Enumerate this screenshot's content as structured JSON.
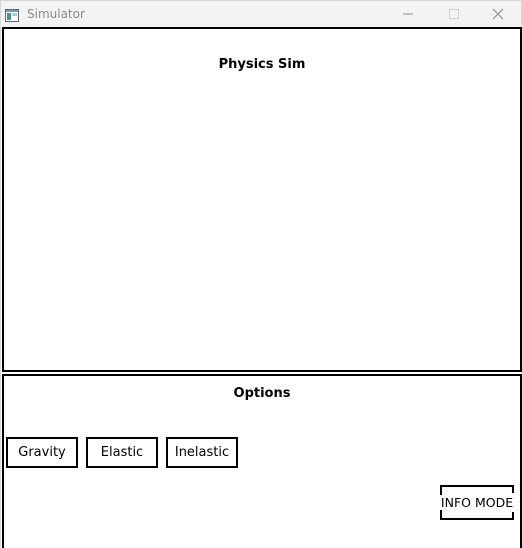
{
  "window": {
    "title": "Simulator"
  },
  "simulation": {
    "title": "Physics Sim"
  },
  "options": {
    "title": "Options",
    "buttons": [
      {
        "label": "Gravity"
      },
      {
        "label": "Elastic"
      },
      {
        "label": "Inelastic"
      }
    ],
    "info_mode_label": "INFO MODE"
  },
  "icons": {
    "app": "window-app-icon",
    "minimize": "minimize-icon",
    "maximize": "maximize-icon",
    "close": "close-icon"
  },
  "colors": {
    "titlebar": "#f3f3f3",
    "title_text": "#8a8a8a",
    "border": "#000000",
    "background": "#ffffff"
  }
}
